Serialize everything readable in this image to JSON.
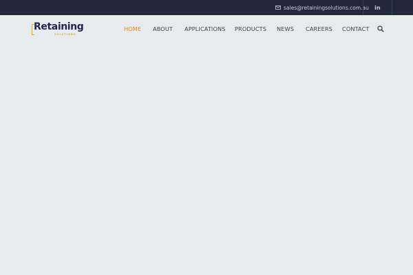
{
  "topbar": {
    "email": "sales@retainingsolutions.com.au",
    "linkedin": "in"
  },
  "logo": {
    "wordmark": "Retaining",
    "tagline": "SOLUTIONS"
  },
  "nav": {
    "items": [
      "HOME",
      "ABOUT",
      "APPLICATIONS",
      "PRODUCTS",
      "NEWS",
      "CAREERS",
      "CONTACT"
    ],
    "active": "HOME"
  },
  "colors": {
    "topbar_bg": "#22283a",
    "page_bg": "#e7ebee",
    "accent": "#d98a1e",
    "brand_navy": "#1f2552"
  },
  "icons": {
    "email": "envelope-icon",
    "social": "linkedin-icon",
    "search": "search-icon"
  }
}
